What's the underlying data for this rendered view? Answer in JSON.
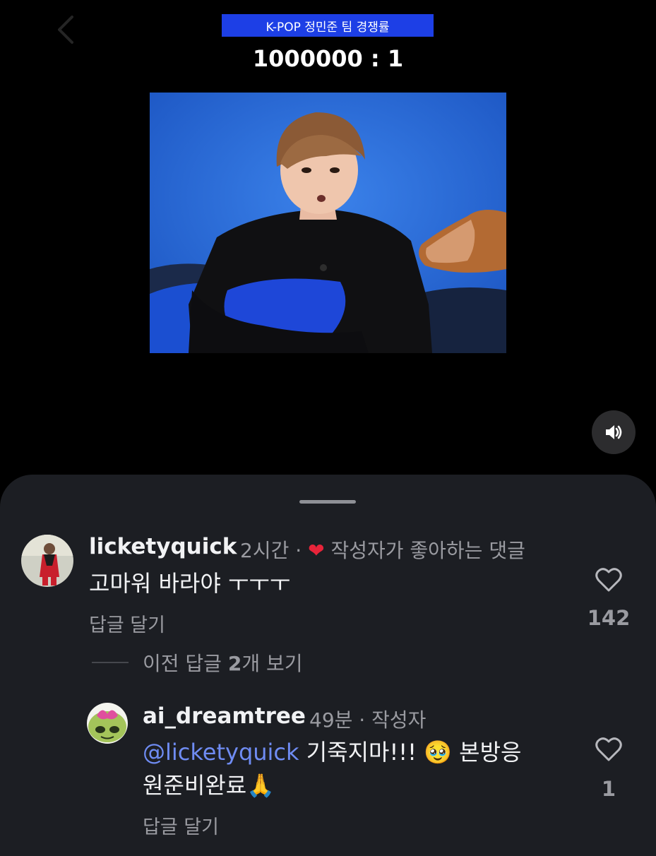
{
  "video": {
    "caption": "K-POP 정민준 팀 경쟁률",
    "ratio": "1000000 : 1"
  },
  "comments": [
    {
      "username": "licketyquick",
      "time": "2시간",
      "separator": "·",
      "creator_liked_label": "작성자가 좋아하는 댓글",
      "text": "고마워 바라야 ㅜㅜㅜ",
      "reply_label": "답글 달기",
      "likes": "142"
    }
  ],
  "view_replies": {
    "prefix": "이전 답글 ",
    "count": "2",
    "suffix": "개 보기"
  },
  "reply": {
    "username": "ai_dreamtree",
    "time": "49분",
    "separator": "·",
    "role": "작성자",
    "mention": "@licketyquick",
    "text_line1": " 기죽지마!!! 🥹 본방응",
    "text_line2": "원준비완료🙏",
    "reply_label": "답글 달기",
    "likes": "1"
  },
  "icons": {
    "back": "chevron-left-icon",
    "sound": "speaker-icon",
    "like": "heart-outline-icon",
    "creator_like": "heart-filled-icon"
  },
  "colors": {
    "caption_bg": "#1d3fe6",
    "sheet_bg": "#1c1e23",
    "mention": "#6f8cf3",
    "heart": "#e8243a"
  }
}
